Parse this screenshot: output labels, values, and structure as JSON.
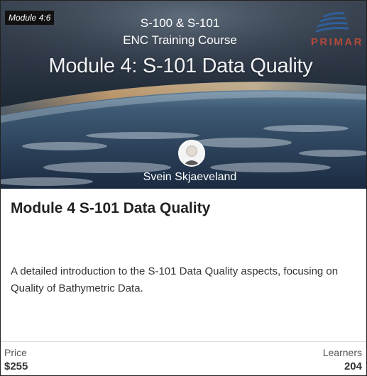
{
  "banner": {
    "module_tag": "Module 4:6",
    "line1": "S-100 & S-101",
    "line2": "ENC Training Course",
    "title": "Module 4: S-101 Data Quality",
    "logo_text": "PRIMAR",
    "instructor": "Svein Skjaeveland",
    "logo_icon": "primar-wave-icon",
    "avatar_icon": "instructor-avatar"
  },
  "course": {
    "title": "Module 4 S-101 Data Quality",
    "description": "A detailed introduction to the S-101 Data Quality aspects, focusing on Quality of Bathymetric Data."
  },
  "footer": {
    "price_label": "Price",
    "price_value": "$255",
    "learners_label": "Learners",
    "learners_value": "204"
  },
  "colors": {
    "logo_red": "#b04a3a",
    "logo_blue": "#2f5f9a"
  }
}
